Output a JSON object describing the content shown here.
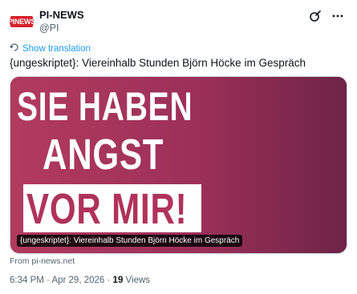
{
  "account": {
    "display_name": "PI-NEWS",
    "handle": "@PI",
    "logo_text": "PINEWS"
  },
  "translate": {
    "label": "Show translation"
  },
  "tweet": {
    "text": "{ungeskriptet}: Viereinhalb Stunden Björn Höcke im Gespräch"
  },
  "media": {
    "headline_line1": "SIE HABEN",
    "headline_line2": "ANGST",
    "headline_line3": "VOR MIR!",
    "caption": "{ungeskriptet}: Viereinhalb Stunden Björn Höcke im Gespräch"
  },
  "source": {
    "from": "From pi-news.net"
  },
  "meta": {
    "time": "6:34 PM",
    "separator": "·",
    "date": "Apr 29, 2026",
    "views_count": "19",
    "views_label": "Views"
  },
  "colors": {
    "accent": "#1d9bf0",
    "brand_red": "#d8202a",
    "media_magenta": "#b0325a"
  }
}
